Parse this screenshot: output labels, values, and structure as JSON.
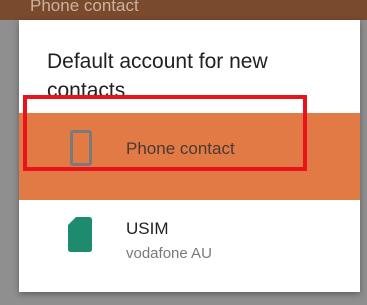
{
  "background": {
    "header_text": "Phone contact"
  },
  "dialog": {
    "title": "Default account for new contacts",
    "accounts": [
      {
        "label": "Phone contact",
        "subtitle": "",
        "icon": "phone-icon",
        "selected": true,
        "color": "#e27a46"
      },
      {
        "label": "USIM",
        "subtitle": "vodafone AU",
        "icon": "sim-card-icon",
        "selected": false,
        "color": "#1e8a6e"
      }
    ]
  },
  "colors": {
    "accent": "#e27a46",
    "highlight_border": "#e8141a",
    "sim_green": "#1e8a6e"
  }
}
